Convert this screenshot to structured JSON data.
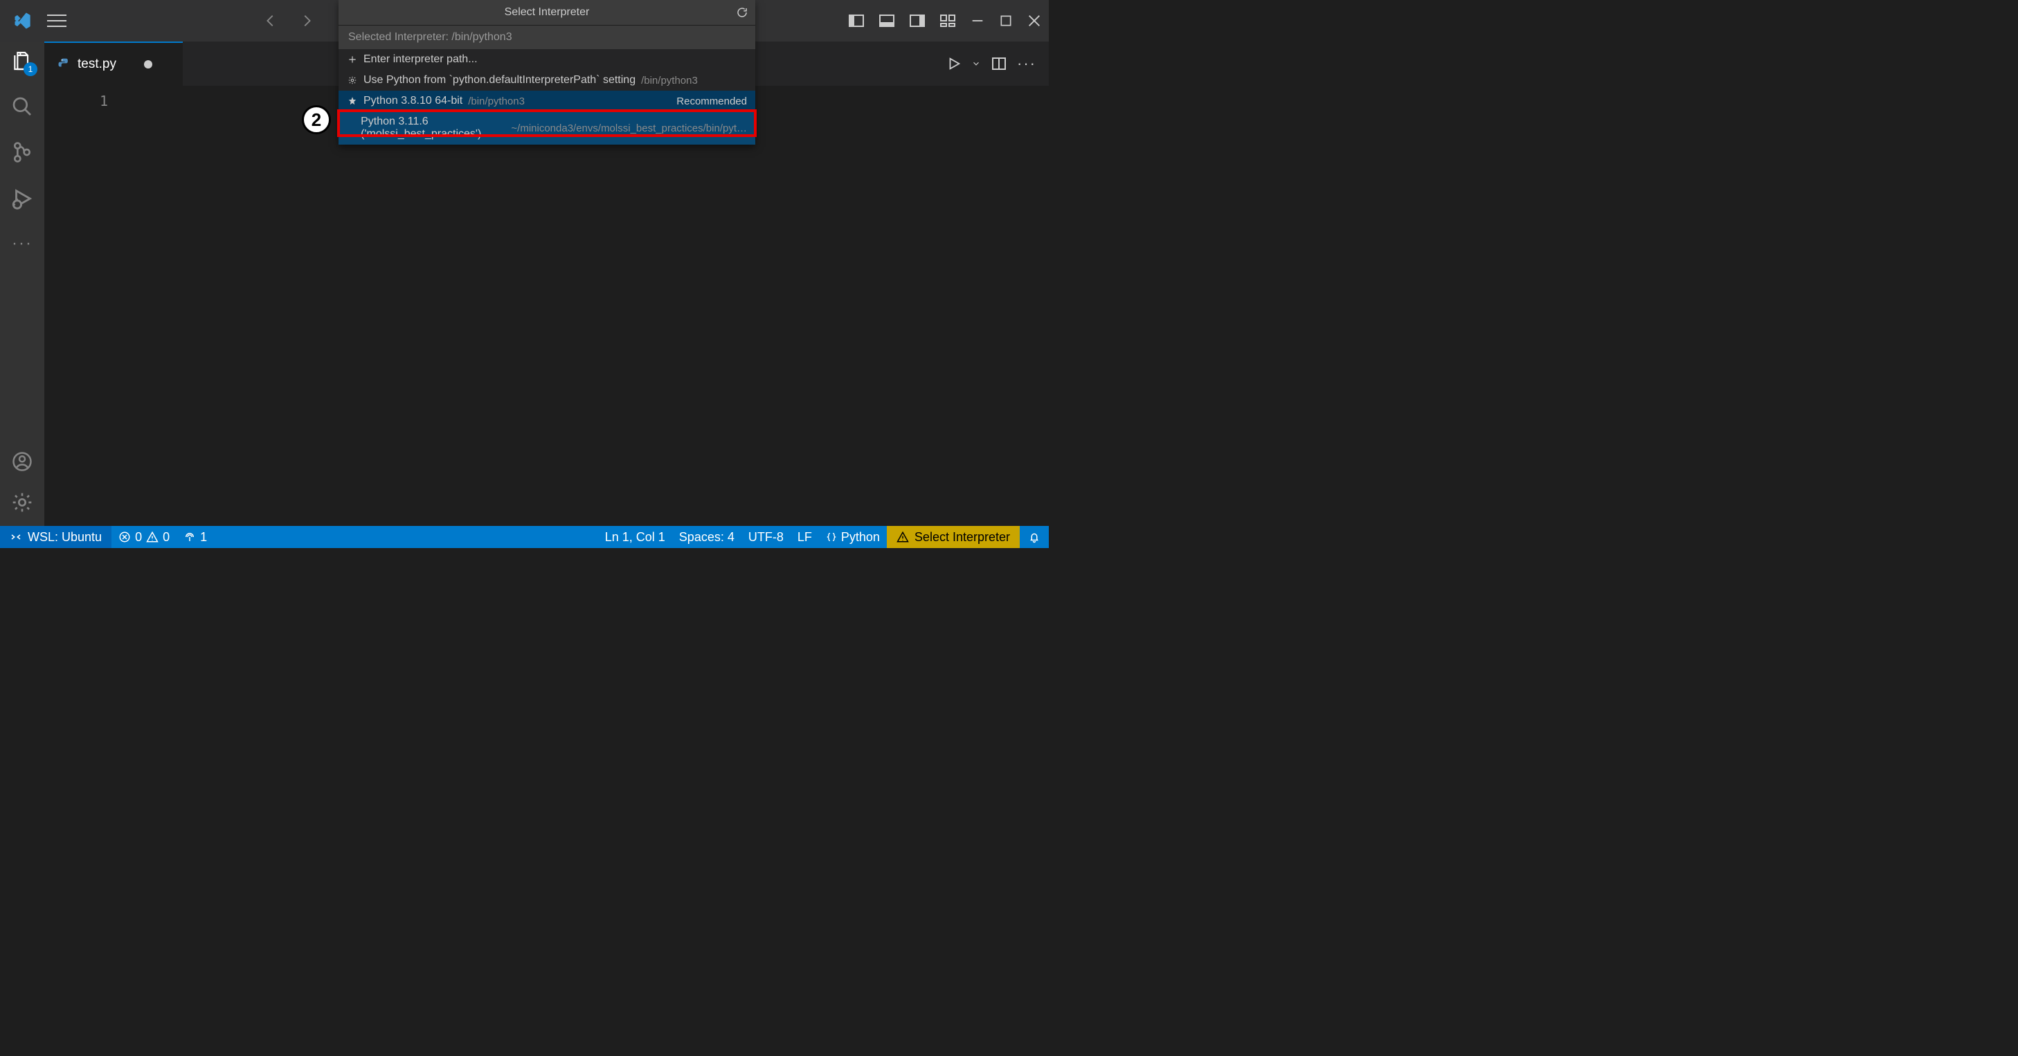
{
  "titlebar": {
    "layout_icons": [
      "panel-left",
      "panel-bottom",
      "panel-right",
      "layout-grid"
    ]
  },
  "activitybar": {
    "explorer_badge": "1"
  },
  "tab": {
    "file_icon": "python",
    "label": "test.py",
    "dirty": true
  },
  "editor": {
    "line_number": "1"
  },
  "quickinput": {
    "title": "Select Interpreter",
    "header": "Selected Interpreter: /bin/python3",
    "items": [
      {
        "icon": "plus",
        "label": "Enter interpreter path...",
        "path": "",
        "right": "",
        "state": ""
      },
      {
        "icon": "gear",
        "label": "Use Python from `python.defaultInterpreterPath` setting",
        "path": "/bin/python3",
        "right": "",
        "state": ""
      },
      {
        "icon": "star",
        "label": "Python 3.8.10 64-bit",
        "path": "/bin/python3",
        "right": "Recommended",
        "state": "selected"
      },
      {
        "icon": "",
        "label": "Python 3.11.6 ('molssi_best_practices')",
        "path": "~/miniconda3/envs/molssi_best_practices/bin/pyt…",
        "right": "",
        "state": "highlight"
      }
    ]
  },
  "annotation": {
    "step_number": "2"
  },
  "statusbar": {
    "remote": "WSL: Ubuntu",
    "errors": "0",
    "warnings": "0",
    "ports": "1",
    "cursor": "Ln 1, Col 1",
    "spaces": "Spaces: 4",
    "encoding": "UTF-8",
    "eol": "LF",
    "language": "Python",
    "interpreter_warn": "Select Interpreter"
  }
}
